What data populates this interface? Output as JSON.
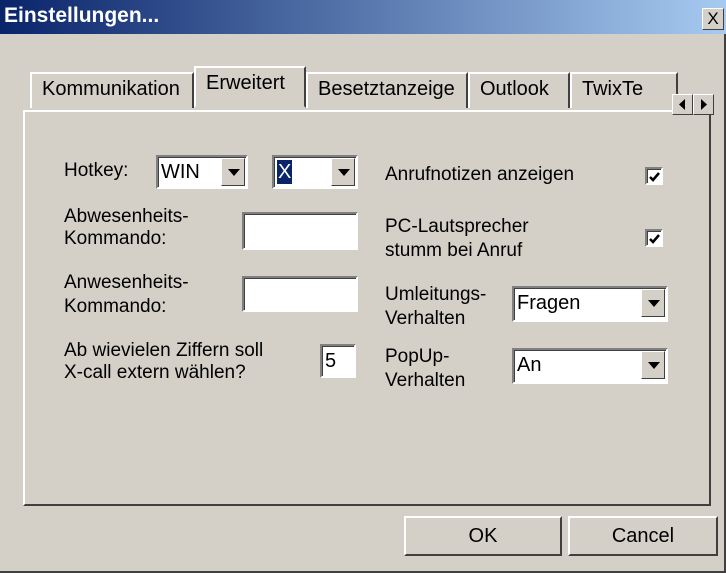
{
  "window": {
    "title": "Einstellungen...",
    "close_symbol": "X"
  },
  "tabs": [
    {
      "label": "Kommunikation",
      "active": false
    },
    {
      "label": "Erweitert",
      "active": true
    },
    {
      "label": "Besetztanzeige",
      "active": false
    },
    {
      "label": "Outlook",
      "active": false
    },
    {
      "label": "TwixTe",
      "active": false
    }
  ],
  "form": {
    "hotkey": {
      "label": "Hotkey:",
      "modifier": "WIN",
      "key": "X"
    },
    "abwesenheit": {
      "label_line1": "Abwesenheits-",
      "label_line2": "Kommando:",
      "value": ""
    },
    "anwesenheit": {
      "label_line1": "Anwesenheits-",
      "label_line2": "Kommando:",
      "value": ""
    },
    "ziffern": {
      "label_line1": "Ab wievielen Ziffern soll",
      "label_line2": "X-call extern wählen?",
      "value": "5"
    },
    "anrufnotizen": {
      "label": "Anrufnotizen anzeigen",
      "checked": true
    },
    "lautsprecher": {
      "label_line1": "PC-Lautsprecher",
      "label_line2": "stumm bei Anruf",
      "checked": true
    },
    "umleitung": {
      "label_line1": "Umleitungs-",
      "label_line2": "Verhalten",
      "value": "Fragen"
    },
    "popup": {
      "label_line1": "PopUp-",
      "label_line2": "Verhalten",
      "value": "An"
    }
  },
  "buttons": {
    "ok": "OK",
    "cancel": "Cancel"
  },
  "colors": {
    "face": "#d4d0c8",
    "title_start": "#0a246a",
    "title_end": "#a6caf0",
    "selection": "#0a246a"
  }
}
